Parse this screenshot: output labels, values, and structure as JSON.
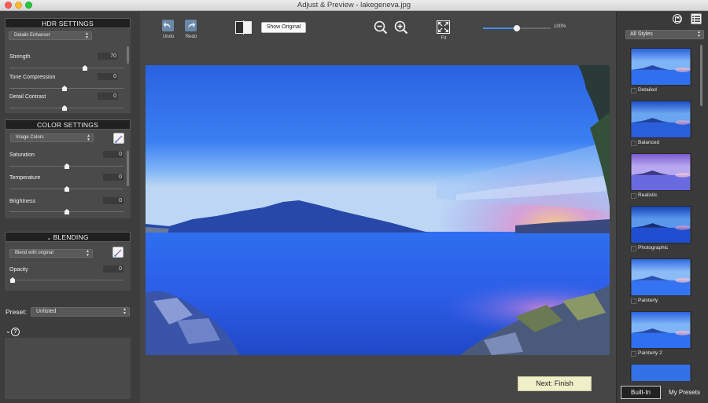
{
  "window": {
    "title": "Adjust & Preview - lakegeneva.jpg"
  },
  "hdr": {
    "heading": "HDR SETTINGS",
    "mode": "Details Enhancer",
    "sliders": [
      {
        "label": "Strength",
        "value": "70",
        "position": 0.7
      },
      {
        "label": "Tone Compression",
        "value": "0",
        "position": 0.5
      },
      {
        "label": "Detail Contrast",
        "value": "0",
        "position": 0.5
      }
    ]
  },
  "color": {
    "heading": "COLOR SETTINGS",
    "mode": "Image Colors",
    "sliders": [
      {
        "label": "Saturation",
        "value": "0",
        "position": 0.5
      },
      {
        "label": "Temperature",
        "value": "0",
        "position": 0.5
      },
      {
        "label": "Brightness",
        "value": "0",
        "position": 0.5
      }
    ]
  },
  "blending": {
    "heading": "BLENDING",
    "mode": "Blend with original",
    "slider": {
      "label": "Opacity",
      "value": "0",
      "position": 0.0
    }
  },
  "preset": {
    "label": "Preset:",
    "value": "Unlisted"
  },
  "toolbar": {
    "undo": "Undo",
    "redo": "Redo",
    "show_original": "Show Original",
    "fit": "Fit",
    "zoom_value": "100%",
    "zoom_position": 0.5
  },
  "next_button": "Next: Finish",
  "styles": {
    "filter": "All Styles",
    "items": [
      "Detailed",
      "Balanced",
      "Realistic",
      "Photographic",
      "Painterly",
      "Painterly 2"
    ],
    "tabs": {
      "builtin": "Built-In",
      "mypresets": "My Presets"
    }
  },
  "colors": {
    "accent": "#3d8ff0",
    "next_button_bg": "#efefc8",
    "panel": "#3d3d3d"
  }
}
